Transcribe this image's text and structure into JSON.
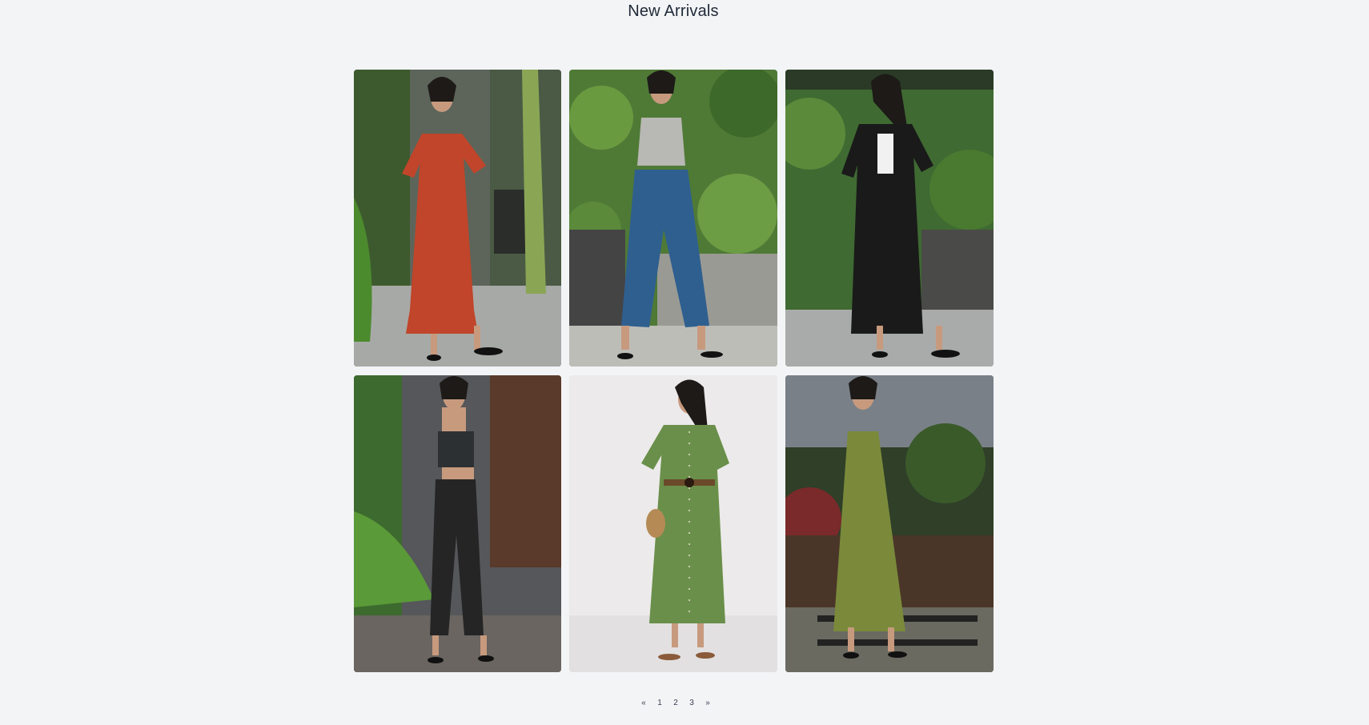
{
  "heading": "New Arrivals",
  "products": [
    {
      "name": "rust-v-neck-tiered-midi-dress",
      "bg": "#6b7263",
      "garment": "#c0452a"
    },
    {
      "name": "grey-bustier-top-wide-leg-jeans",
      "bg": "#4f7a36",
      "garment": "#2f5f8f"
    },
    {
      "name": "black-long-kimono-cover-up",
      "bg": "#3f6a32",
      "garment": "#1a1a1a"
    },
    {
      "name": "black-crop-top-satin-trousers",
      "bg": "#5a4436",
      "garment": "#252525"
    },
    {
      "name": "green-button-down-midi-dress",
      "bg": "#eceaea",
      "garment": "#6a8f4a"
    },
    {
      "name": "olive-sleeveless-tiered-maxi-dress",
      "bg": "#2f3f28",
      "garment": "#7a8a3a"
    }
  ],
  "pagination": {
    "prev": "«",
    "pages": [
      "1",
      "2",
      "3"
    ],
    "next": "»"
  }
}
